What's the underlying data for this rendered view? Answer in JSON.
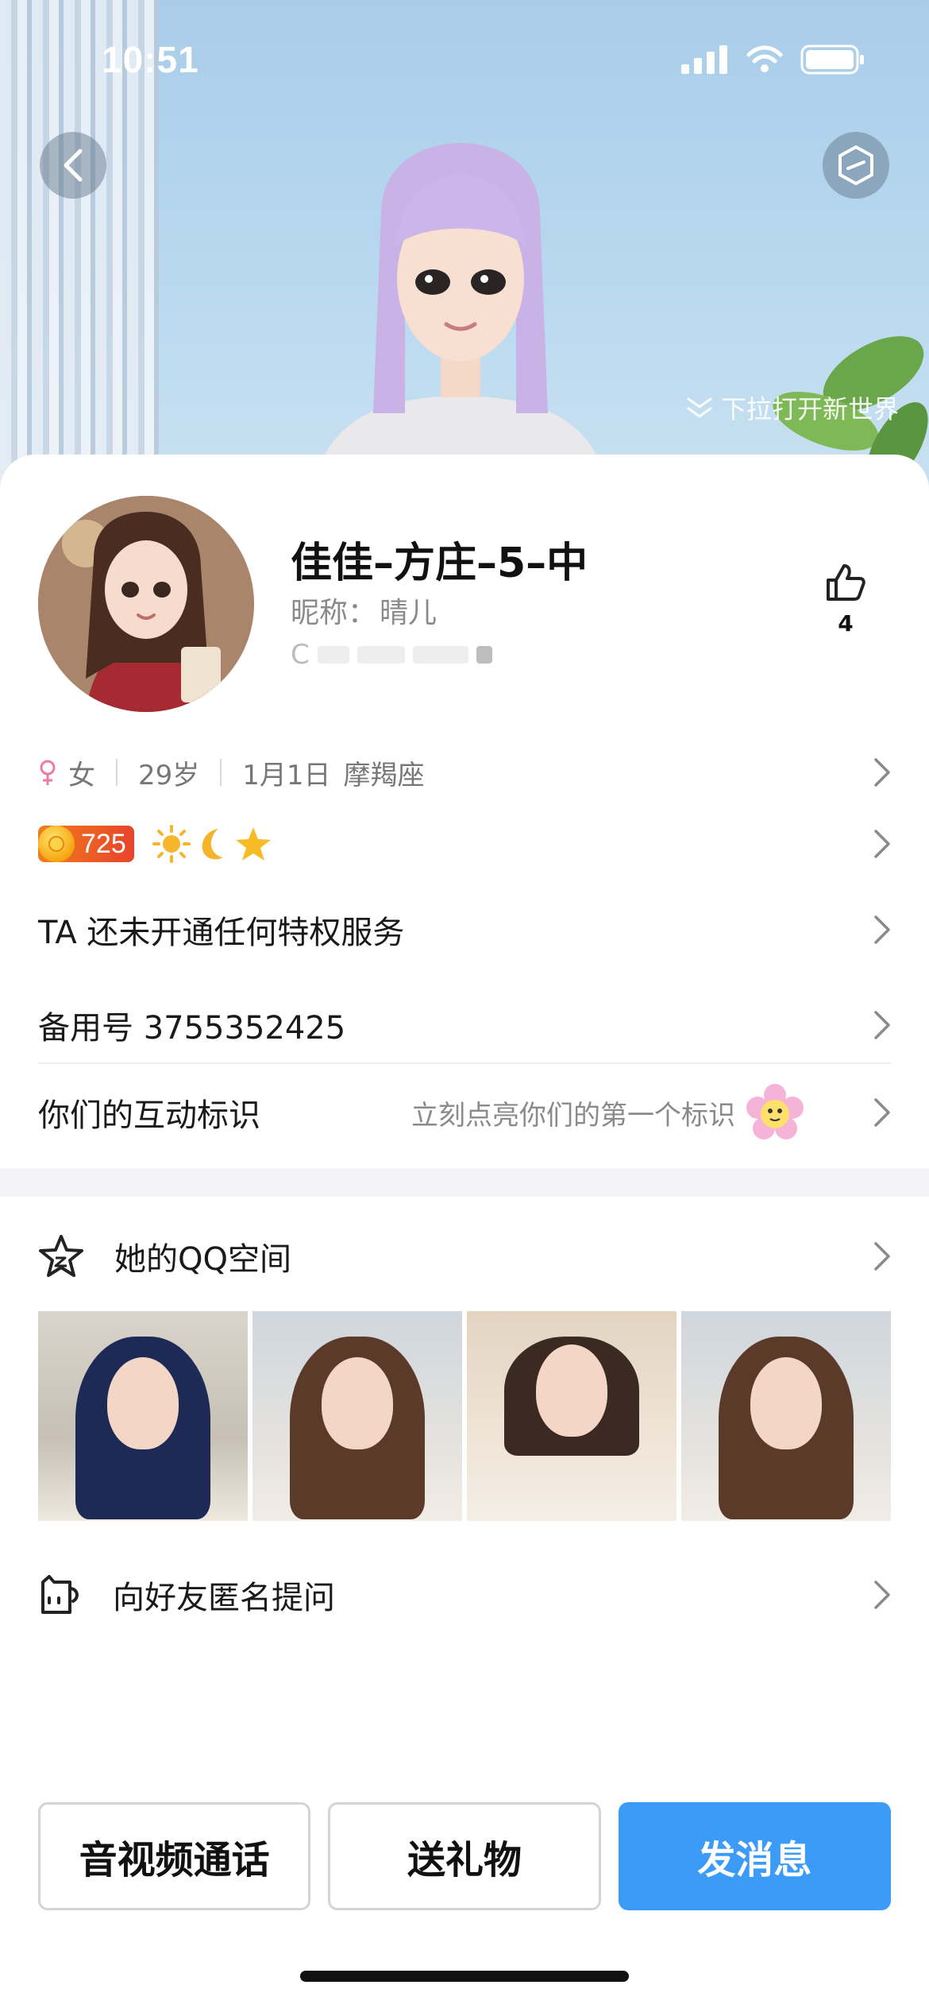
{
  "status": {
    "time": "10:51"
  },
  "hero": {
    "pull_hint": "下拉打开新世界"
  },
  "profile": {
    "name": "佳佳–方庄–5–中",
    "nickname_label": "昵称：",
    "nickname": "晴儿",
    "qq_prefix": "C",
    "likes": "4"
  },
  "info": {
    "gender": "女",
    "age": "29岁",
    "birthday": "1月1日",
    "zodiac": "摩羯座"
  },
  "level": {
    "value": "725"
  },
  "menu": {
    "vip": "TA 还未开通任何特权服务",
    "backup": "备用号 3755352425",
    "interaction": "你们的互动标识",
    "interaction_hint": "立刻点亮你们的第一个标识"
  },
  "qzone": {
    "title": "她的QQ空间"
  },
  "ask": {
    "title": "向好友匿名提问"
  },
  "actions": {
    "call": "音视频通话",
    "gift": "送礼物",
    "message": "发消息"
  },
  "colors": {
    "primary": "#3d9bf8",
    "level": "#e8442a"
  }
}
